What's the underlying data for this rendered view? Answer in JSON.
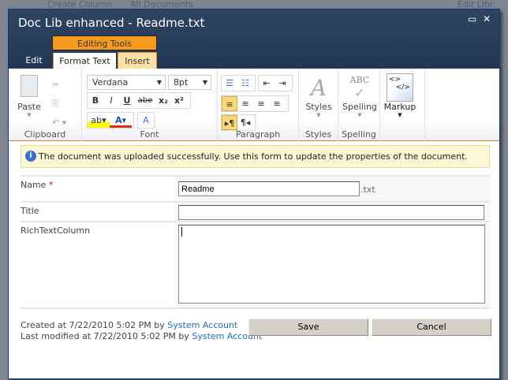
{
  "background": {
    "items": [
      "Create Column",
      "All Documents",
      "Edit Libr"
    ]
  },
  "dialog": {
    "title": "Doc Lib enhanced - Readme.txt",
    "maximize_icon": "maximize-icon",
    "close_icon": "close-icon"
  },
  "ribbon": {
    "context_group": "Editing Tools",
    "tabs": [
      "Edit",
      "Format Text",
      "Insert"
    ],
    "groups": {
      "clipboard": "Clipboard",
      "font": "Font",
      "paragraph": "Paragraph",
      "styles": "Styles",
      "spelling": "Spelling"
    },
    "paste": "Paste",
    "font_name": "Verdana",
    "font_size": "8pt",
    "styles": "Styles",
    "spelling": "Spelling",
    "markup": "Markup",
    "font_buttons": [
      "B",
      "I",
      "U",
      "abe",
      "x₂",
      "x²"
    ]
  },
  "message": "The document was uploaded successfully. Use this form to update the properties of the document.",
  "form": {
    "name_label": "Name",
    "required": "*",
    "name_value": "Readme",
    "extension": ".txt",
    "title_label": "Title",
    "title_value": "",
    "rich_label": "RichTextColumn"
  },
  "footer": {
    "created_prefix": "Created at 7/22/2010 5:02 PM by",
    "created_by": "System Account",
    "modified_prefix": "Last modified at 7/22/2010 5:02 PM by",
    "modified_by": "System Account"
  },
  "buttons": {
    "save": "Save",
    "cancel": "Cancel"
  }
}
